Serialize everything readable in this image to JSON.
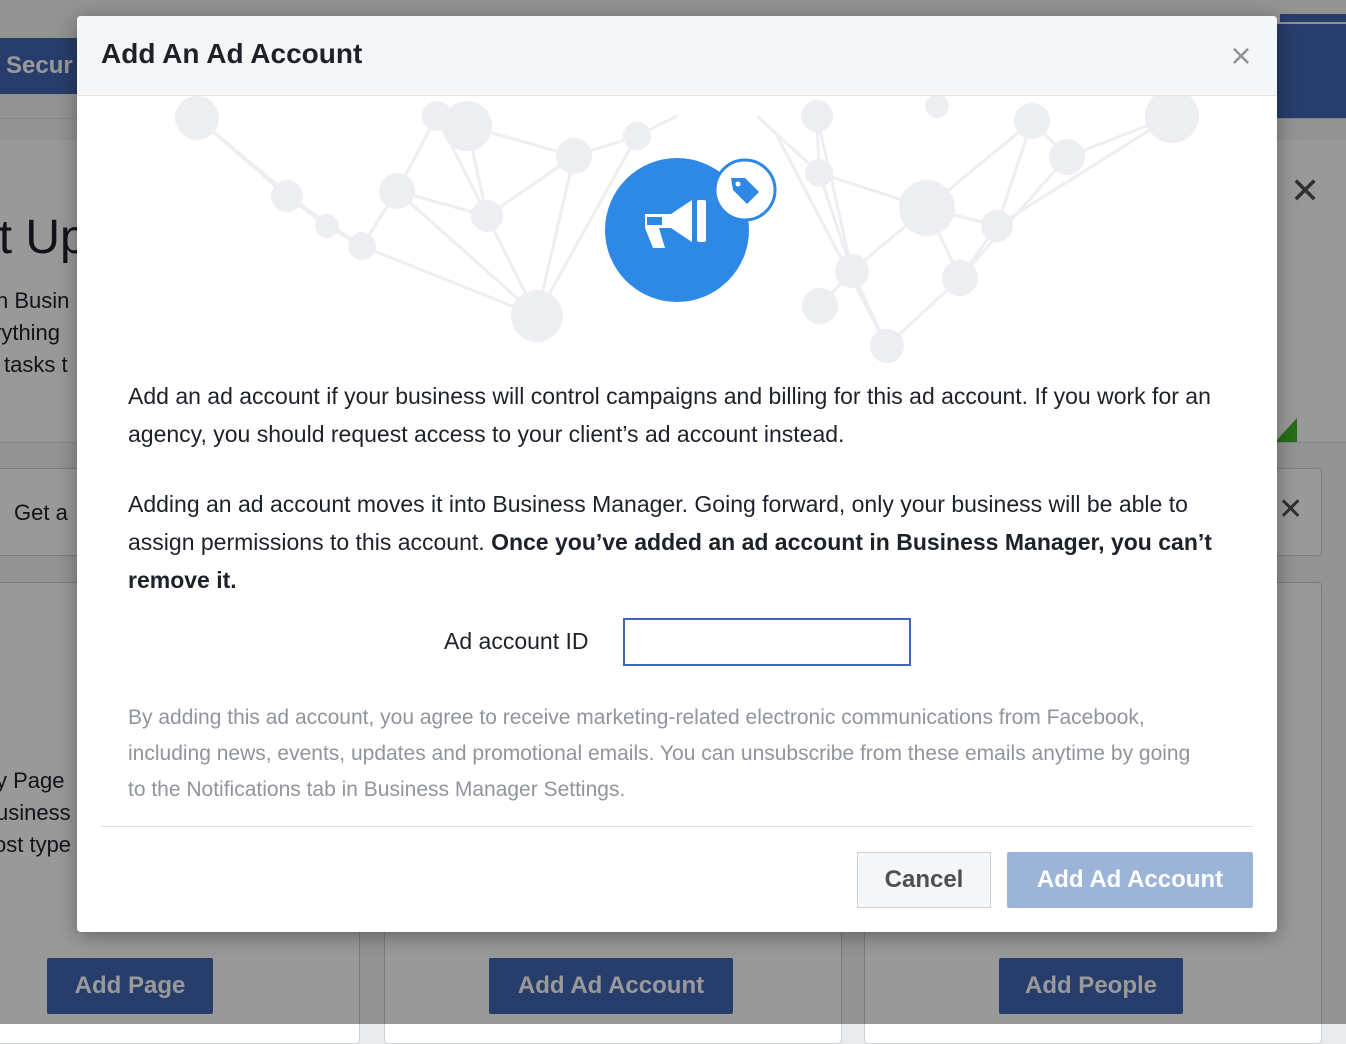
{
  "background": {
    "security_label": "Secur",
    "setup_title": "et Up",
    "setup_lines": [
      "n Busin",
      "rything",
      "tasks t"
    ],
    "getbar_text": "Get a",
    "card_lines": [
      "y Page",
      "usiness",
      "ost type"
    ],
    "buttons": {
      "add_page": "Add Page",
      "add_ad_account": "Add Ad Account",
      "add_people": "Add People"
    }
  },
  "dialog": {
    "title": "Add An Ad Account",
    "close_icon": "close-icon",
    "hero_icon": "megaphone-icon",
    "badge_icon": "tag-icon",
    "paragraph1": "Add an ad account if your business will control campaigns and billing for this ad account. If you work for an agency, you should request access to your client’s ad account instead.",
    "paragraph2_plain": "Adding an ad account moves it into Business Manager. Going forward, only your business will be able to assign permissions to this account. ",
    "paragraph2_bold": "Once you’ve added an ad account in Business Manager, you can’t remove it.",
    "field_label": "Ad account ID",
    "field_value": "",
    "legal": "By adding this ad account, you agree to receive marketing-related electronic communications from Facebook, including news, events, updates and promotional emails. You can unsubscribe from these emails anytime by going to the Notifications tab in Business Manager Settings.",
    "cancel_label": "Cancel",
    "submit_label": "Add Ad Account"
  },
  "colors": {
    "primary": "#4267b2",
    "icon_blue": "#2d88e6",
    "disabled_button": "#9cb4d8",
    "muted_text": "#90949c"
  }
}
